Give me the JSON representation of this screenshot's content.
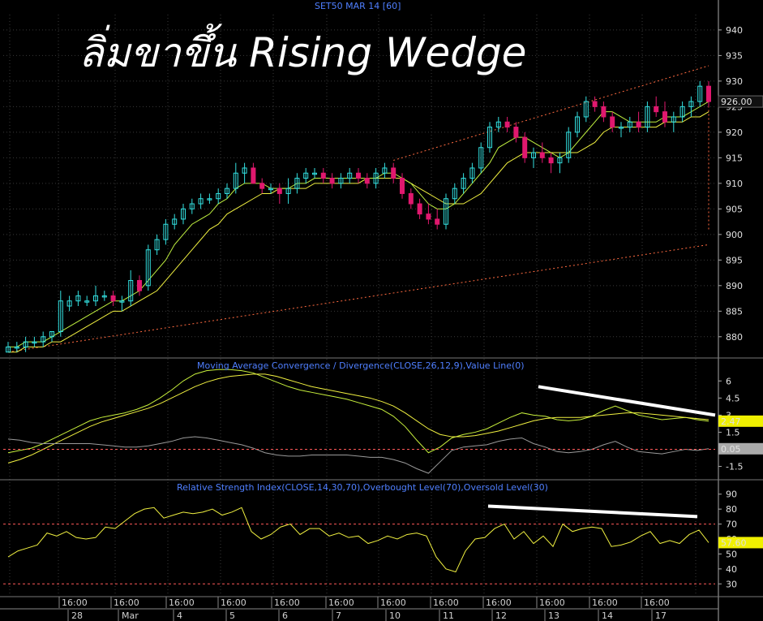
{
  "header": {
    "symbol": "SET50 MAR 14  [60]",
    "annotation": "ลิ่มขาขึ้น Rising Wedge"
  },
  "colors": {
    "background": "#000000",
    "bull": "#33e0e0",
    "bear": "#e0186e",
    "ma_fast": "#c0f040",
    "ma_slow": "#f0f040",
    "channel": "#ff6a40",
    "grid": "#3a3a3a",
    "last_tag": "#f0f000"
  },
  "chart_data": [
    {
      "type": "candlestick",
      "panel": "price",
      "y_ticks": [
        880,
        885,
        890,
        895,
        900,
        905,
        910,
        915,
        920,
        925,
        930,
        935,
        940
      ],
      "ylim": [
        876,
        943
      ],
      "last_value": "926.00",
      "ohlc": [
        [
          877,
          879,
          877,
          878
        ],
        [
          878,
          879,
          877,
          878
        ],
        [
          878,
          880,
          877,
          879
        ],
        [
          879,
          880,
          878,
          879
        ],
        [
          879,
          881,
          878,
          880
        ],
        [
          880,
          881,
          879,
          881
        ],
        [
          881,
          889,
          880,
          887
        ],
        [
          886,
          888,
          885,
          887
        ],
        [
          887,
          889,
          886,
          888
        ],
        [
          887,
          888,
          886,
          887
        ],
        [
          887,
          890,
          886,
          888
        ],
        [
          888,
          889,
          887,
          888
        ],
        [
          888,
          889,
          886,
          887
        ],
        [
          887,
          888,
          885,
          887
        ],
        [
          887,
          893,
          886,
          891
        ],
        [
          891,
          892,
          888,
          889
        ],
        [
          890,
          898,
          889,
          897
        ],
        [
          897,
          900,
          896,
          899
        ],
        [
          899,
          903,
          898,
          902
        ],
        [
          902,
          904,
          901,
          903
        ],
        [
          903,
          906,
          902,
          905
        ],
        [
          905,
          907,
          904,
          906
        ],
        [
          906,
          908,
          905,
          907
        ],
        [
          907,
          908,
          906,
          907
        ],
        [
          907,
          909,
          906,
          908
        ],
        [
          908,
          910,
          907,
          909
        ],
        [
          909,
          914,
          908,
          912
        ],
        [
          912,
          914,
          910,
          913
        ],
        [
          913,
          914,
          910,
          910
        ],
        [
          910,
          911,
          908,
          909
        ],
        [
          909,
          910,
          908,
          909
        ],
        [
          909,
          910,
          906,
          908
        ],
        [
          908,
          911,
          906,
          909
        ],
        [
          909,
          912,
          908,
          911
        ],
        [
          911,
          913,
          910,
          912
        ],
        [
          912,
          913,
          911,
          912
        ],
        [
          912,
          913,
          910,
          911
        ],
        [
          911,
          912,
          909,
          910
        ],
        [
          910,
          912,
          909,
          911
        ],
        [
          911,
          913,
          910,
          912
        ],
        [
          912,
          913,
          910,
          911
        ],
        [
          911,
          912,
          909,
          910
        ],
        [
          910,
          913,
          909,
          912
        ],
        [
          912,
          914,
          911,
          913
        ],
        [
          913,
          914,
          910,
          911
        ],
        [
          911,
          912,
          907,
          908
        ],
        [
          908,
          909,
          905,
          906
        ],
        [
          906,
          907,
          903,
          904
        ],
        [
          904,
          906,
          902,
          903
        ],
        [
          903,
          905,
          901,
          902
        ],
        [
          902,
          908,
          901,
          907
        ],
        [
          907,
          910,
          906,
          909
        ],
        [
          909,
          912,
          908,
          911
        ],
        [
          911,
          914,
          910,
          913
        ],
        [
          913,
          918,
          912,
          917
        ],
        [
          917,
          922,
          916,
          921
        ],
        [
          921,
          923,
          920,
          922
        ],
        [
          922,
          923,
          920,
          921
        ],
        [
          921,
          922,
          918,
          919
        ],
        [
          919,
          920,
          914,
          915
        ],
        [
          915,
          917,
          913,
          916
        ],
        [
          916,
          918,
          914,
          915
        ],
        [
          915,
          916,
          912,
          914
        ],
        [
          914,
          916,
          912,
          915
        ],
        [
          915,
          921,
          914,
          920
        ],
        [
          920,
          924,
          919,
          923
        ],
        [
          923,
          927,
          922,
          926
        ],
        [
          926,
          927,
          924,
          925
        ],
        [
          925,
          926,
          922,
          923
        ],
        [
          923,
          924,
          920,
          921
        ],
        [
          921,
          922,
          919,
          921
        ],
        [
          921,
          923,
          920,
          922
        ],
        [
          922,
          924,
          920,
          921
        ],
        [
          921,
          926,
          920,
          925
        ],
        [
          925,
          927,
          923,
          924
        ],
        [
          924,
          926,
          921,
          922
        ],
        [
          922,
          924,
          920,
          923
        ],
        [
          923,
          926,
          922,
          925
        ],
        [
          925,
          927,
          923,
          926
        ],
        [
          926,
          930,
          925,
          929
        ],
        [
          929,
          930,
          925,
          926
        ]
      ],
      "ma_fast": [
        878,
        878,
        879,
        879,
        879,
        880,
        881,
        882,
        883,
        884,
        885,
        886,
        887,
        887,
        888,
        889,
        891,
        893,
        895,
        898,
        900,
        902,
        903,
        904,
        906,
        907,
        909,
        910,
        910,
        910,
        909,
        909,
        909,
        910,
        910,
        911,
        911,
        911,
        911,
        911,
        911,
        911,
        911,
        912,
        912,
        911,
        910,
        908,
        906,
        905,
        905,
        906,
        908,
        910,
        912,
        914,
        917,
        918,
        919,
        919,
        918,
        917,
        916,
        915,
        916,
        918,
        920,
        922,
        924,
        924,
        923,
        922,
        922,
        922,
        922,
        923,
        923,
        923,
        924,
        925,
        926
      ],
      "ma_slow": [
        877,
        877,
        878,
        878,
        878,
        879,
        879,
        880,
        881,
        882,
        883,
        884,
        885,
        885,
        886,
        887,
        888,
        889,
        891,
        893,
        895,
        897,
        899,
        901,
        902,
        904,
        905,
        906,
        907,
        908,
        908,
        909,
        909,
        909,
        909,
        910,
        910,
        910,
        910,
        910,
        910,
        911,
        911,
        911,
        911,
        911,
        910,
        909,
        908,
        907,
        906,
        906,
        906,
        907,
        908,
        910,
        912,
        914,
        915,
        916,
        916,
        916,
        916,
        916,
        916,
        916,
        917,
        918,
        920,
        921,
        921,
        921,
        921,
        921,
        921,
        922,
        922,
        922,
        923,
        923,
        924
      ],
      "channel_lines": [
        {
          "p1": [
            44,
            914.5
          ],
          "p2": [
            80,
            933
          ]
        },
        {
          "p1": [
            80,
            901
          ],
          "p2": [
            80,
            926
          ]
        },
        {
          "p1": [
            0,
            877
          ],
          "p2": [
            80,
            898
          ]
        }
      ]
    },
    {
      "type": "line",
      "panel": "macd",
      "title": "Moving Average Convergence / Divergence(CLOSE,26,12,9),Value Line(0)",
      "y_ticks": [
        "6",
        "4.5",
        "3",
        "1.5",
        "0",
        "-1.5"
      ],
      "y_tick_values": [
        6,
        4.5,
        3,
        1.5,
        0,
        -1.5
      ],
      "ylim": [
        -2.6,
        7.8
      ],
      "last_value": "2.47",
      "last_value_2": "0.05",
      "series": [
        {
          "values": [
            -0.3,
            -0.1,
            0.1,
            0.5,
            1.0,
            1.5,
            2.0,
            2.5,
            2.8,
            3.0,
            3.2,
            3.5,
            3.9,
            4.5,
            5.2,
            6.0,
            6.6,
            6.9,
            7.0,
            7.0,
            6.9,
            6.7,
            6.3,
            5.9,
            5.5,
            5.2,
            5.0,
            4.8,
            4.6,
            4.4,
            4.1,
            3.8,
            3.5,
            2.9,
            2.0,
            0.8,
            -0.3,
            0.2,
            1.0,
            1.3,
            1.5,
            1.8,
            2.3,
            2.8,
            3.2,
            3.0,
            2.9,
            2.6,
            2.5,
            2.6,
            2.9,
            3.4,
            3.8,
            3.4,
            3.0,
            2.8,
            2.6,
            2.7,
            2.8,
            2.6,
            2.47
          ]
        },
        {
          "values": [
            -1.2,
            -0.9,
            -0.5,
            0.0,
            0.5,
            1.0,
            1.5,
            2.0,
            2.4,
            2.7,
            3.0,
            3.3,
            3.6,
            4.0,
            4.5,
            5.0,
            5.5,
            5.9,
            6.2,
            6.4,
            6.5,
            6.6,
            6.6,
            6.4,
            6.1,
            5.8,
            5.5,
            5.3,
            5.1,
            4.9,
            4.7,
            4.5,
            4.2,
            3.8,
            3.2,
            2.5,
            1.8,
            1.3,
            1.1,
            1.1,
            1.2,
            1.4,
            1.6,
            1.9,
            2.2,
            2.5,
            2.7,
            2.8,
            2.8,
            2.8,
            2.9,
            3.0,
            3.1,
            3.2,
            3.2,
            3.1,
            3.0,
            2.9,
            2.8,
            2.7,
            2.6
          ]
        },
        {
          "values": [
            0.9,
            0.8,
            0.6,
            0.5,
            0.5,
            0.5,
            0.5,
            0.5,
            0.4,
            0.3,
            0.2,
            0.2,
            0.3,
            0.5,
            0.7,
            1.0,
            1.1,
            1.0,
            0.8,
            0.6,
            0.4,
            0.1,
            -0.3,
            -0.5,
            -0.6,
            -0.6,
            -0.5,
            -0.5,
            -0.5,
            -0.5,
            -0.6,
            -0.7,
            -0.7,
            -0.9,
            -1.2,
            -1.7,
            -2.1,
            -1.1,
            -0.1,
            0.2,
            0.3,
            0.4,
            0.7,
            0.9,
            1.0,
            0.5,
            0.2,
            -0.2,
            -0.3,
            -0.2,
            0.0,
            0.4,
            0.7,
            0.2,
            -0.2,
            -0.3,
            -0.4,
            -0.2,
            0.0,
            -0.1,
            0.05
          ]
        }
      ]
    },
    {
      "type": "line",
      "panel": "rsi",
      "title": "Relative Strength Index(CLOSE,14,30,70),Overbought Level(70),Oversold Level(30)",
      "y_ticks": [
        "90",
        "80",
        "70",
        "60",
        "50",
        "40",
        "30"
      ],
      "y_tick_values": [
        90,
        80,
        70,
        60,
        50,
        40,
        30
      ],
      "ylim": [
        22,
        98
      ],
      "levels": [
        70,
        30
      ],
      "last_value": "57.60",
      "series": [
        {
          "values": [
            48,
            52,
            54,
            56,
            64,
            62,
            65,
            61,
            60,
            61,
            68,
            67,
            72,
            77,
            80,
            81,
            74,
            76,
            78,
            77,
            78,
            80,
            76,
            78,
            81,
            65,
            60,
            63,
            68,
            70,
            63,
            67,
            67,
            62,
            64,
            61,
            62,
            57,
            59,
            62,
            60,
            63,
            64,
            62,
            48,
            40,
            38,
            52,
            60,
            61,
            67,
            70,
            60,
            65,
            57,
            62,
            55,
            70,
            65,
            67,
            68,
            67,
            55,
            56,
            58,
            62,
            65,
            57,
            59,
            57,
            63,
            66,
            57.6
          ]
        }
      ]
    }
  ],
  "x_axis": {
    "time_labels": [
      "16:00",
      "16:00",
      "16:00",
      "16:00",
      "16:00",
      "16:00",
      "16:00",
      "16:00",
      "16:00",
      "16:00",
      "16:00",
      "16:00"
    ],
    "date_labels": [
      "28",
      "Mar",
      "4",
      "5",
      "6",
      "7",
      "10",
      "11",
      "12",
      "13",
      "14",
      "17"
    ]
  }
}
